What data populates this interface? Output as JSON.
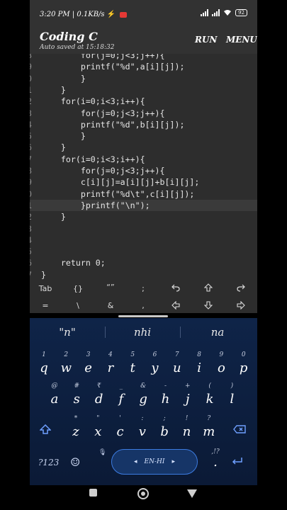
{
  "status_bar": {
    "time_speed": "3:20 PM | 0.1KB/s",
    "battery": "92"
  },
  "app_bar": {
    "title": "Coding C",
    "autosave": "Auto saved at 15:18:32",
    "run_label": "RUN",
    "menu_label": "MENU"
  },
  "editor": {
    "lines": [
      {
        "n": "8",
        "code": "        for(j=0;j<3;j++){"
      },
      {
        "n": "9",
        "code": "        printf(\"%d\",a[i][j]);"
      },
      {
        "n": "0",
        "code": "        }"
      },
      {
        "n": "1",
        "code": "    }"
      },
      {
        "n": "2",
        "code": "    for(i=0;i<3;i++){"
      },
      {
        "n": "3",
        "code": "        for(j=0;j<3;j++){"
      },
      {
        "n": "4",
        "code": "        printf(\"%d\",b[i][j]);"
      },
      {
        "n": "5",
        "code": "        }"
      },
      {
        "n": "6",
        "code": "    }"
      },
      {
        "n": "7",
        "code": "    for(i=0;i<3;i++){"
      },
      {
        "n": "8",
        "code": "        for(j=0;j<3;j++){"
      },
      {
        "n": "9",
        "code": "        c[i][j]=a[i][j]+b[i][j];"
      },
      {
        "n": "0",
        "code": "        printf(\"%d\\t\",c[i][j]);"
      },
      {
        "n": "1",
        "code": "        }printf(\"\\n\");"
      },
      {
        "n": "2",
        "code": "    }"
      },
      {
        "n": "3",
        "code": ""
      },
      {
        "n": "4",
        "code": ""
      },
      {
        "n": "5",
        "code": ""
      },
      {
        "n": "6",
        "code": "    return 0;"
      },
      {
        "n": "7",
        "code": "}"
      }
    ]
  },
  "symbol_bar": {
    "row1": [
      "Tab",
      "{}",
      "“”",
      ";",
      "undo",
      "up",
      "redo"
    ],
    "row2": [
      "=",
      "\\",
      "&",
      ",",
      "left",
      "down",
      "right"
    ]
  },
  "keyboard": {
    "suggestions": [
      "\"n\"",
      "nhi",
      "na"
    ],
    "row1": {
      "keys": [
        "q",
        "w",
        "e",
        "r",
        "t",
        "y",
        "u",
        "i",
        "o",
        "p"
      ],
      "hints": [
        "",
        "1",
        "2",
        "3",
        "4",
        "5",
        "6",
        "7",
        "8",
        "9",
        "0"
      ]
    },
    "row2": {
      "keys": [
        "a",
        "s",
        "d",
        "f",
        "g",
        "h",
        "j",
        "k",
        "l"
      ],
      "hints": [
        "@",
        "#",
        "₹",
        "_",
        "&",
        "-",
        "+",
        "(",
        ")"
      ]
    },
    "row3": {
      "keys": [
        "z",
        "x",
        "c",
        "v",
        "b",
        "n",
        "m"
      ],
      "hints": [
        "*",
        "\"",
        "'",
        ":",
        ";",
        "!",
        "?"
      ]
    },
    "num_label": "?123",
    "lang_label": "EN-HI",
    "period": ".",
    "period_hint": ",!?"
  }
}
